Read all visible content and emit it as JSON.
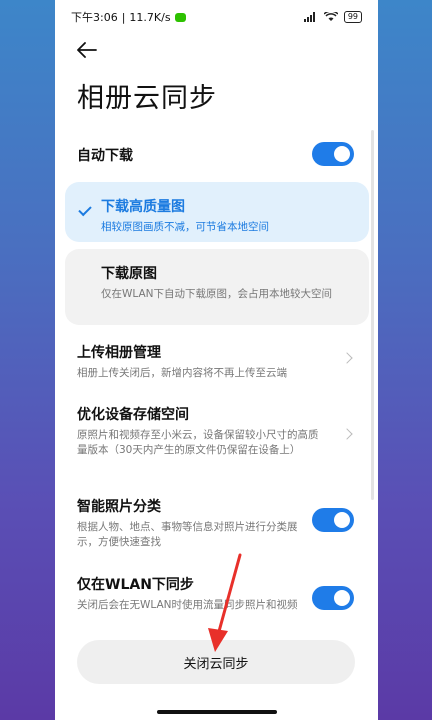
{
  "status_bar": {
    "time": "下午3:06",
    "speed": "11.7K/s",
    "battery": "99"
  },
  "header": {
    "title": "相册云同步"
  },
  "auto_download": {
    "label": "自动下载",
    "enabled": true
  },
  "options": [
    {
      "title": "下载高质量图",
      "desc": "相较原图画质不减，可节省本地空间",
      "selected": true
    },
    {
      "title": "下载原图",
      "desc": "仅在WLAN下自动下载原图，会占用本地较大空间",
      "selected": false
    }
  ],
  "upload_album": {
    "label": "上传相册管理",
    "desc": "相册上传关闭后，新增内容将不再上传至云端"
  },
  "optimize_storage": {
    "label": "优化设备存储空间",
    "desc": "原照片和视频存至小米云，设备保留较小尺寸的高质量版本（30天内产生的原文件仍保留在设备上）"
  },
  "smart_classify": {
    "label": "智能照片分类",
    "desc": "根据人物、地点、事物等信息对照片进行分类展示，方便快速查找",
    "enabled": true
  },
  "wlan_only": {
    "label": "仅在WLAN下同步",
    "desc": "关闭后会在无WLAN时使用流量同步照片和视频",
    "enabled": true
  },
  "footer": {
    "close_label": "关闭云同步"
  },
  "colors": {
    "accent": "#1f7ce8",
    "annotation_arrow": "#e8302a"
  }
}
